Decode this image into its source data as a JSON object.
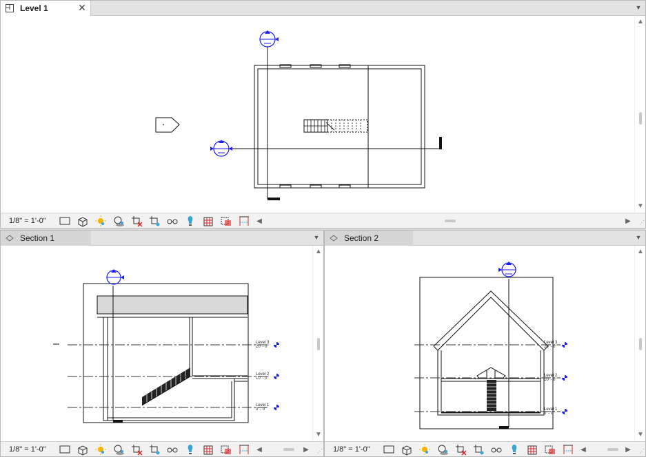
{
  "views": {
    "level1": {
      "tab_label": "Level 1",
      "close_label": "✕",
      "scale": "1/8\" = 1'-0\""
    },
    "section1": {
      "tab_label": "Section 1",
      "scale": "1/8\" = 1'-0\"",
      "levels": [
        {
          "name": "Level 3",
          "elev": "20' - 0\""
        },
        {
          "name": "Level 2",
          "elev": "10' - 0\""
        },
        {
          "name": "Level 1",
          "elev": "0' - 0\""
        }
      ]
    },
    "section2": {
      "tab_label": "Section 2",
      "scale": "1/8\" = 1'-0\"",
      "levels": [
        {
          "name": "Level 3",
          "elev": "20' - 0\""
        },
        {
          "name": "Level 2",
          "elev": "10' - 0\""
        },
        {
          "name": "Level 1",
          "elev": "0' - 0\""
        }
      ]
    }
  },
  "toolbar_icons": [
    "detail-level-icon",
    "visual-style-icon",
    "sun-path-icon",
    "shadows-icon",
    "crop-view-icon",
    "crop-region-icon",
    "temporary-hide-icon",
    "reveal-hidden-icon",
    "analytical-model-icon",
    "highlight-displacement-icon",
    "reveal-constraints-icon"
  ],
  "colors": {
    "annotation_blue": "#1a1aff",
    "accent_red": "#e02020"
  }
}
